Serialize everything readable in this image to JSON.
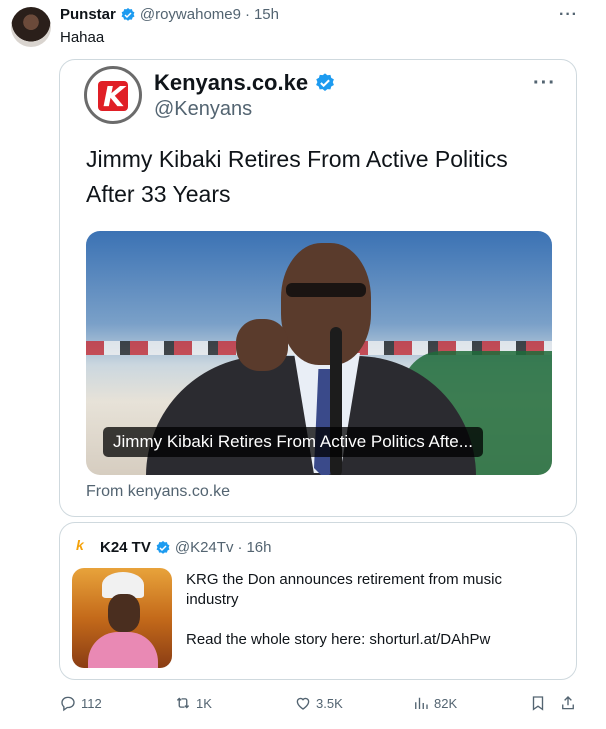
{
  "post": {
    "author_name": "Punstar",
    "author_handle": "@roywahome9",
    "time": "15h",
    "text": "Hahaa"
  },
  "card": {
    "name": "Kenyans.co.ke",
    "handle": "@Kenyans",
    "headline": "Jimmy Kibaki Retires From Active Politics After 33 Years",
    "image_caption": "Jimmy Kibaki Retires From Active Politics Afte...",
    "source": "From kenyans.co.ke",
    "logo_letter": "K"
  },
  "quote": {
    "logo_text": "k",
    "name": "K24 TV",
    "handle": "@K24Tv",
    "time": "16h",
    "line1": "KRG the Don announces retirement from music industry",
    "line2": "Read the whole story here: shorturl.at/DAhPw"
  },
  "actions": {
    "replies": "112",
    "reposts": "1K",
    "likes": "3.5K",
    "views": "82K"
  },
  "colors": {
    "verified": "#1d9bf0",
    "muted": "#536471",
    "border": "#cfd9de",
    "brand_red": "#e01f26"
  },
  "icons": [
    "verified-badge-icon",
    "more-icon",
    "reply-icon",
    "repost-icon",
    "like-icon",
    "views-icon",
    "bookmark-icon",
    "share-icon"
  ]
}
